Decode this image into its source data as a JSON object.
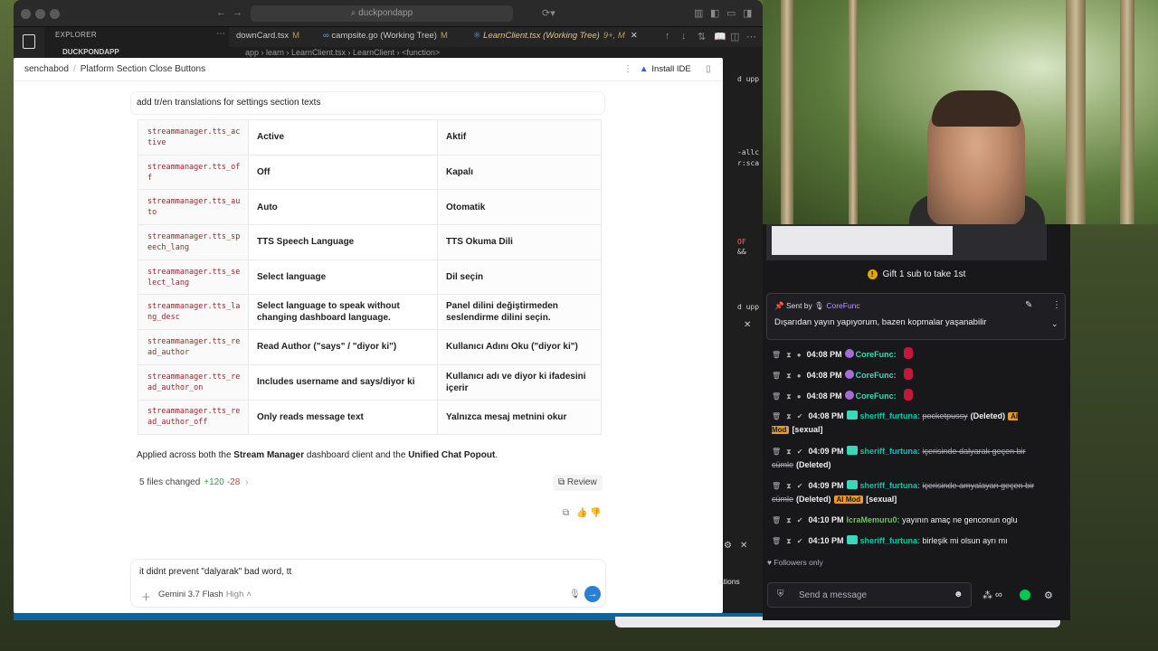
{
  "window": {
    "search_text": "duckpondapp",
    "explorer_label": "EXPLORER",
    "project_label": "DUCKPONDAPP"
  },
  "editor_tabs": [
    {
      "label": "downCard.tsx",
      "mark": "M"
    },
    {
      "label": "campsite.go (Working Tree)",
      "mark": "M"
    },
    {
      "label": "LearnClient.tsx (Working Tree)",
      "mark": "9+, M"
    }
  ],
  "editor_breadcrumb": "app  ›  learn  ›  LearnClient.tsx  ›  LearnClient  ›  <function>",
  "code_snippets": [
    "d upp",
    "-allc",
    "r:sca",
    "OF",
    "&&",
    "d upp"
  ],
  "chat": {
    "breadcrumb": [
      "senchabod",
      "Platform Section Close Buttons"
    ],
    "install_ide": "Install IDE",
    "user_message": "add tr/en translations for settings section texts",
    "table": [
      {
        "key": "streammanager.tts_active",
        "en": "Active",
        "tr": "Aktif"
      },
      {
        "key": "streammanager.tts_off",
        "en": "Off",
        "tr": "Kapalı"
      },
      {
        "key": "streammanager.tts_auto",
        "en": "Auto",
        "tr": "Otomatik"
      },
      {
        "key": "streammanager.tts_speech_lang",
        "en": "TTS Speech Language",
        "tr": "TTS Okuma Dili"
      },
      {
        "key": "streammanager.tts_select_lang",
        "en": "Select language",
        "tr": "Dil seçin"
      },
      {
        "key": "streammanager.tts_lang_desc",
        "en": "Select language to speak without changing dashboard language.",
        "tr": "Panel dilini değiştirmeden seslendirme dilini seçin."
      },
      {
        "key": "streammanager.tts_read_author",
        "en": "Read Author (\"says\" / \"diyor ki\")",
        "tr": "Kullanıcı Adını Oku (\"diyor ki\")"
      },
      {
        "key": "streammanager.tts_read_author_on",
        "en": "Includes username and says/diyor ki",
        "tr": "Kullanıcı adı ve diyor ki ifadesini içerir"
      },
      {
        "key": "streammanager.tts_read_author_off",
        "en": "Only reads message text",
        "tr": "Yalnızca mesaj metnini okur"
      }
    ],
    "applied": {
      "pre": "Applied across both the ",
      "b1": "Stream Manager",
      "mid": " dashboard client and the ",
      "b2": "Unified Chat Popout",
      "post": "."
    },
    "files": {
      "label": "5 files changed",
      "added": "+120",
      "removed": "-28",
      "review": "Review"
    },
    "composer": {
      "text": "it didnt prevent \"dalyarak\" bad word, tt",
      "model": "Gemini 3.7 Flash",
      "effort": "High"
    }
  },
  "stream_chat": {
    "gift": "Gift 1 sub to take 1st",
    "pinned": {
      "sent_by_label": "Sent by",
      "user": "CoreFunc",
      "text": "Dışarıdan yayın yapıyorum, bazen kopmalar yaşanabilir"
    },
    "messages": [
      {
        "time": "04:08 PM",
        "user": "CoreFunc:"
      },
      {
        "time": "04:08 PM",
        "user": "CoreFunc:"
      },
      {
        "time": "04:08 PM",
        "user": "CoreFunc:"
      },
      {
        "time": "04:08 PM",
        "user": "sheriff_furtuna:",
        "text": "pocketpussy",
        "deleted": "(Deleted)",
        "mod": "AI Mod",
        "tag": "[sexual]"
      },
      {
        "time": "04:09 PM",
        "user": "sheriff_furtuna:",
        "text": "içerisinde dalyarak geçen bir cümle",
        "deleted": "(Deleted)"
      },
      {
        "time": "04:09 PM",
        "user": "sheriff_furtuna:",
        "text": "içerisinde amyalayan geçen bir cümle",
        "deleted": "(Deleted)",
        "mod": "AI Mod",
        "tag": "[sexual]"
      },
      {
        "time": "04:10 PM",
        "user": "IcraMemuru0:",
        "text": "yayının amaç ne genconun oglu"
      },
      {
        "time": "04:10 PM",
        "user": "sheriff_furtuna:",
        "text": "birleşik mi olsun ayrı mı"
      }
    ],
    "followers_only": "Followers only",
    "send_placeholder": "Send a message",
    "side_label": "ations"
  },
  "colors": {
    "accent": "#2a7fd6",
    "twitch_bg": "#18181b",
    "mod_badge": "#e69b2a",
    "add": "#2e9c49",
    "remove": "#d23b3b"
  }
}
